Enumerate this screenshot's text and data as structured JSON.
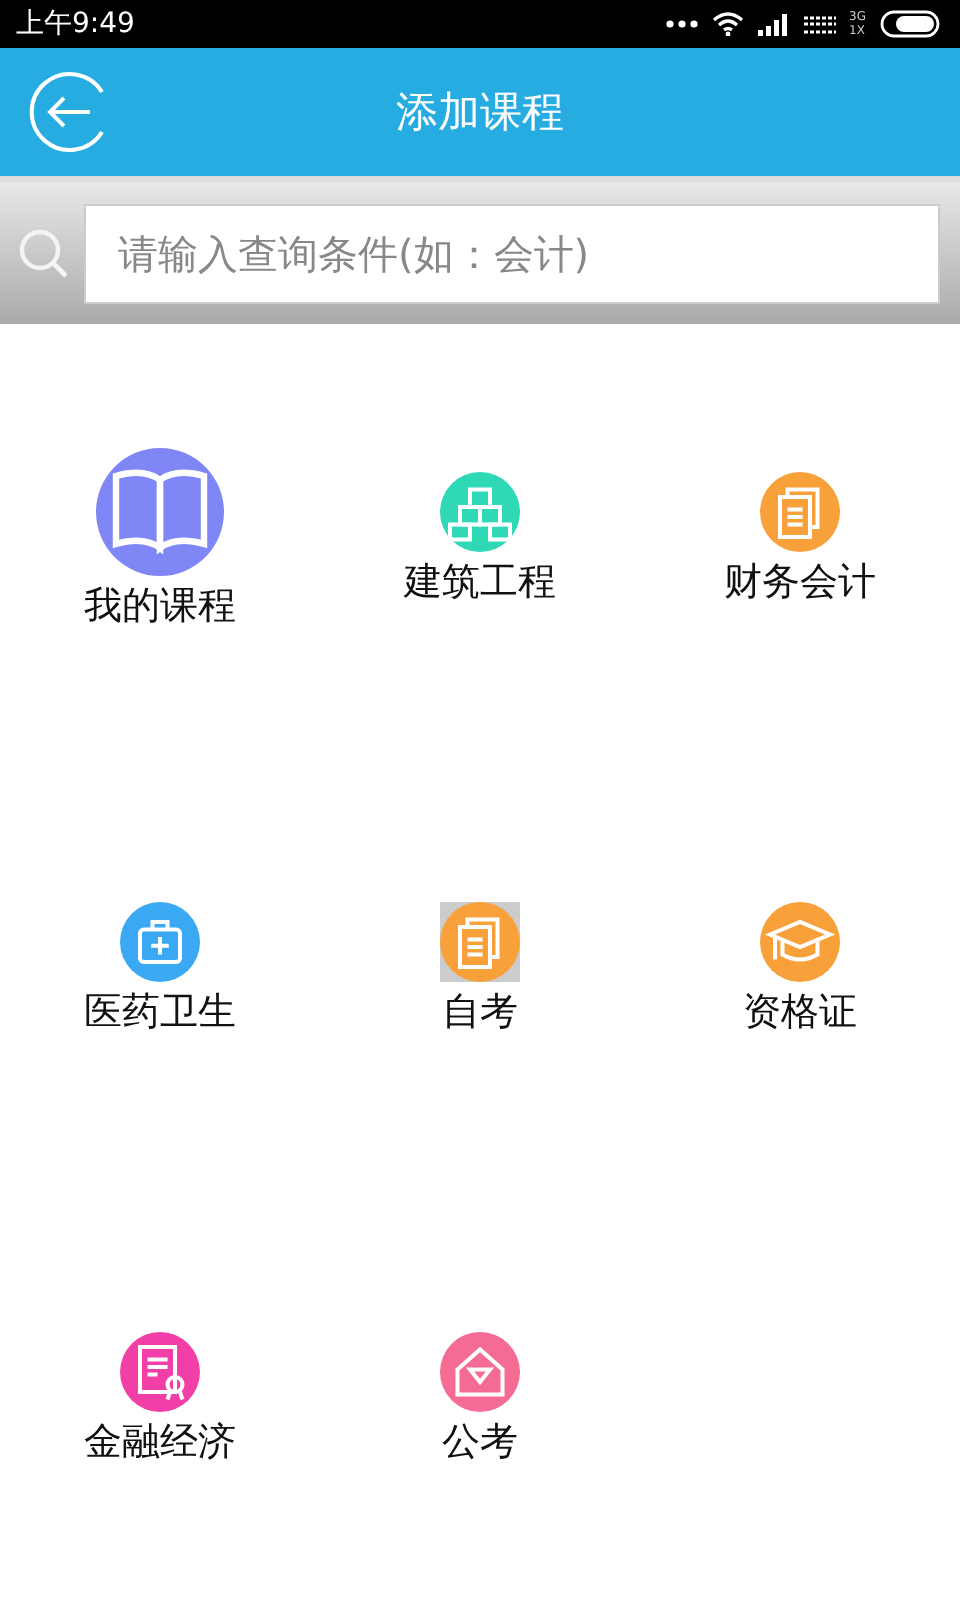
{
  "status_bar": {
    "time": "上午9:49",
    "network_top": "3G",
    "network_bottom": "1X"
  },
  "header": {
    "title": "添加课程"
  },
  "search": {
    "placeholder": "请输入查询条件(如：会计)"
  },
  "categories": [
    {
      "label": "我的课程",
      "kind": "book",
      "color": "#7f86f5",
      "featured": true,
      "selected": false
    },
    {
      "label": "建筑工程",
      "kind": "cubes",
      "color": "#2fd9b5",
      "featured": false,
      "selected": false
    },
    {
      "label": "财务会计",
      "kind": "documents",
      "color": "#f8a03a",
      "featured": false,
      "selected": false
    },
    {
      "label": "医药卫生",
      "kind": "medkit",
      "color": "#3aa8f2",
      "featured": false,
      "selected": false
    },
    {
      "label": "自考",
      "kind": "documents",
      "color": "#f8a03a",
      "featured": false,
      "selected": true
    },
    {
      "label": "资格证",
      "kind": "mortarboard",
      "color": "#f8a03a",
      "featured": false,
      "selected": false
    },
    {
      "label": "金融经济",
      "kind": "certificate",
      "color": "#f23fa8",
      "featured": false,
      "selected": false
    },
    {
      "label": "公考",
      "kind": "house",
      "color": "#f46b93",
      "featured": false,
      "selected": false
    }
  ]
}
